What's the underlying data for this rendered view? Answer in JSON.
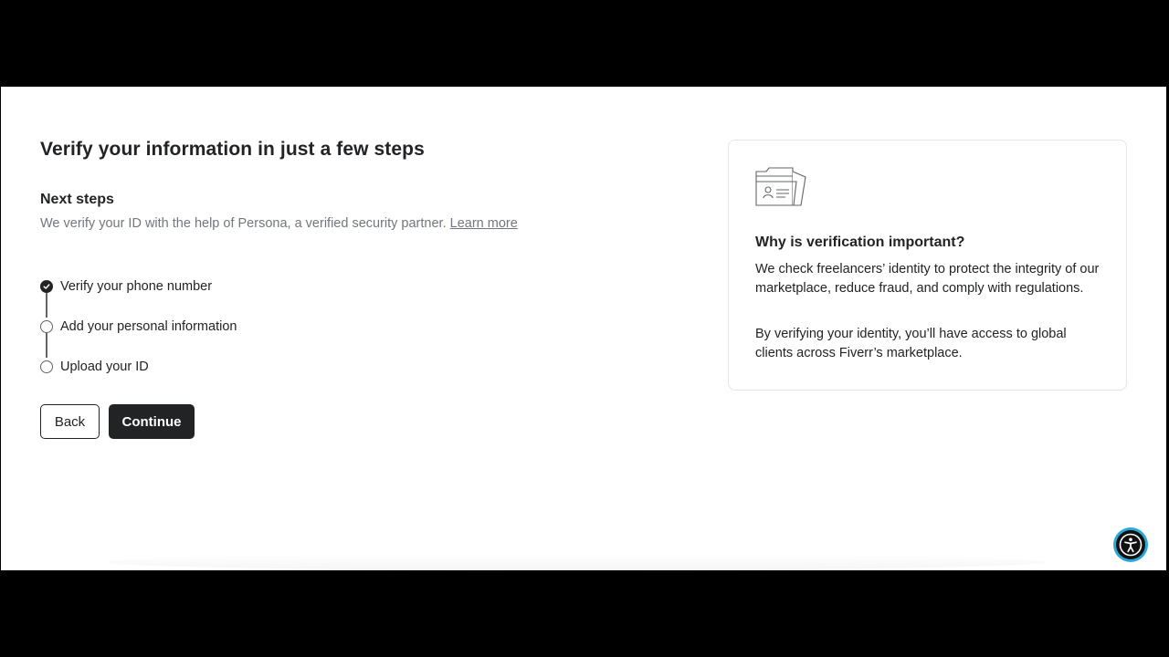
{
  "page": {
    "title": "Verify your information in just a few steps"
  },
  "next_steps": {
    "heading": "Next steps",
    "description": "We verify your ID with the help of Persona, a verified security partner. ",
    "learn_more": "Learn more"
  },
  "steps": [
    {
      "label": "Verify your phone number",
      "completed": true
    },
    {
      "label": "Add your personal information",
      "completed": false
    },
    {
      "label": "Upload your ID",
      "completed": false
    }
  ],
  "buttons": {
    "back": "Back",
    "continue": "Continue"
  },
  "info_card": {
    "icon": "id-folder-icon",
    "title": "Why is verification important?",
    "paragraph1": "We check freelancers’ identity to protect the integrity of our marketplace, reduce fraud, and comply with regulations.",
    "paragraph2": "By verifying your identity, you’ll have access to global clients across Fiverr’s marketplace."
  },
  "accessibility": {
    "icon": "accessibility-icon"
  },
  "colors": {
    "text_primary": "#222325",
    "text_secondary": "#74767e",
    "accessibility_ring": "#2aa8d8"
  }
}
